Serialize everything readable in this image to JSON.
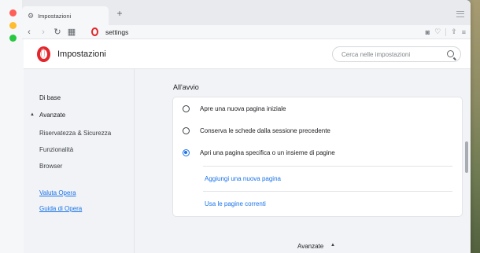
{
  "browser": {
    "tab_title": "Impostazioni",
    "new_tab": "+",
    "url": "settings",
    "icons": [
      "gear-icon",
      "back-icon",
      "forward-icon",
      "reload-icon",
      "grid-icon",
      "camera-icon",
      "heart-icon",
      "share-icon",
      "menu-icon"
    ]
  },
  "header": {
    "title": "Impostazioni",
    "search_placeholder": "Cerca nelle impostazioni"
  },
  "sidebar": {
    "items": [
      {
        "label": "Di base"
      },
      {
        "label": "Avanzate"
      },
      {
        "label": "Riservatezza & Sicurezza"
      },
      {
        "label": "Funzionalità"
      },
      {
        "label": "Browser"
      }
    ],
    "links": [
      {
        "label": "Valuta Opera"
      },
      {
        "label": "Guida di Opera"
      }
    ]
  },
  "main": {
    "section_title": "All'avvio",
    "options": [
      {
        "label": "Apre una nuova pagina iniziale",
        "selected": false
      },
      {
        "label": "Conserva le schede dalla sessione precedente",
        "selected": false
      },
      {
        "label": "Apri una pagina specifica o un insieme di pagine",
        "selected": true
      }
    ],
    "actions": [
      {
        "label": "Aggiungi una nuova pagina"
      },
      {
        "label": "Usa le pagine correnti"
      }
    ],
    "footer_label": "Avanzate"
  },
  "colors": {
    "accent": "#1a73e8",
    "brand": "#e1262c"
  }
}
